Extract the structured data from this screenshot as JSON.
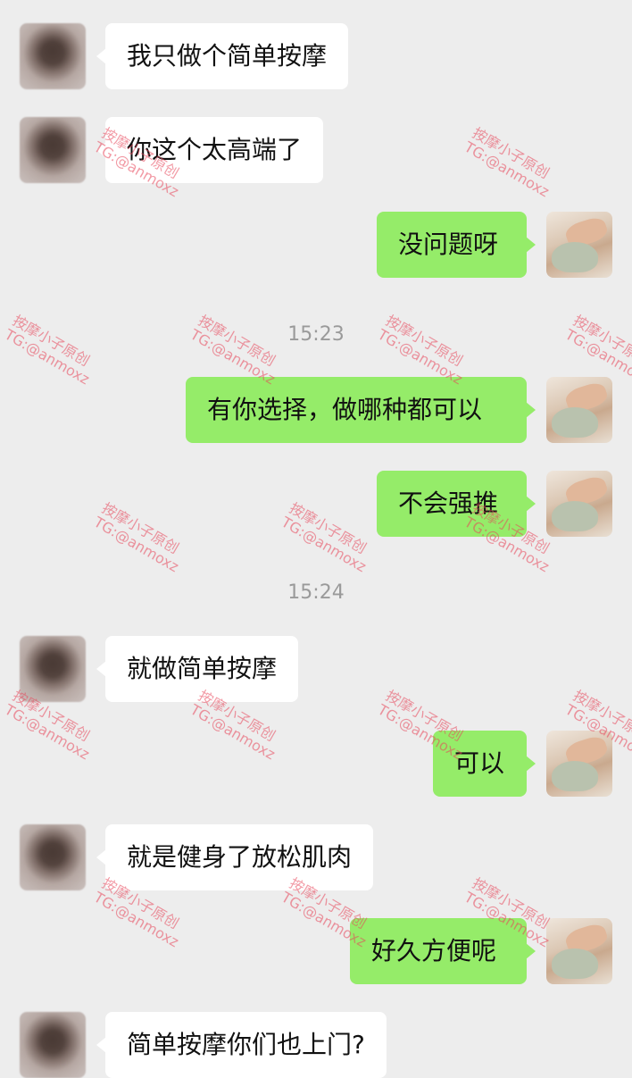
{
  "messages": [
    {
      "side": "left",
      "text": "我只做个简单按摩"
    },
    {
      "side": "left",
      "text": "你这个太高端了"
    },
    {
      "side": "right",
      "text": "没问题呀"
    },
    {
      "side": "right",
      "text": "有你选择，做哪种都可以"
    },
    {
      "side": "right",
      "text": "不会强推"
    },
    {
      "side": "left",
      "text": "就做简单按摩"
    },
    {
      "side": "right",
      "text": "可以"
    },
    {
      "side": "left",
      "text": "就是健身了放松肌肉"
    },
    {
      "side": "right",
      "text": "好久方便呢"
    },
    {
      "side": "left",
      "text": "简单按摩你们也上门?"
    }
  ],
  "timestamps": [
    "15:23",
    "15:24"
  ],
  "watermark": {
    "line1": "按摩小子原创",
    "line2": "TG:@anmoxz"
  },
  "colors": {
    "background": "#ededed",
    "bubble_self": "#95ec69",
    "bubble_other": "#ffffff",
    "watermark": "#e8465a"
  }
}
